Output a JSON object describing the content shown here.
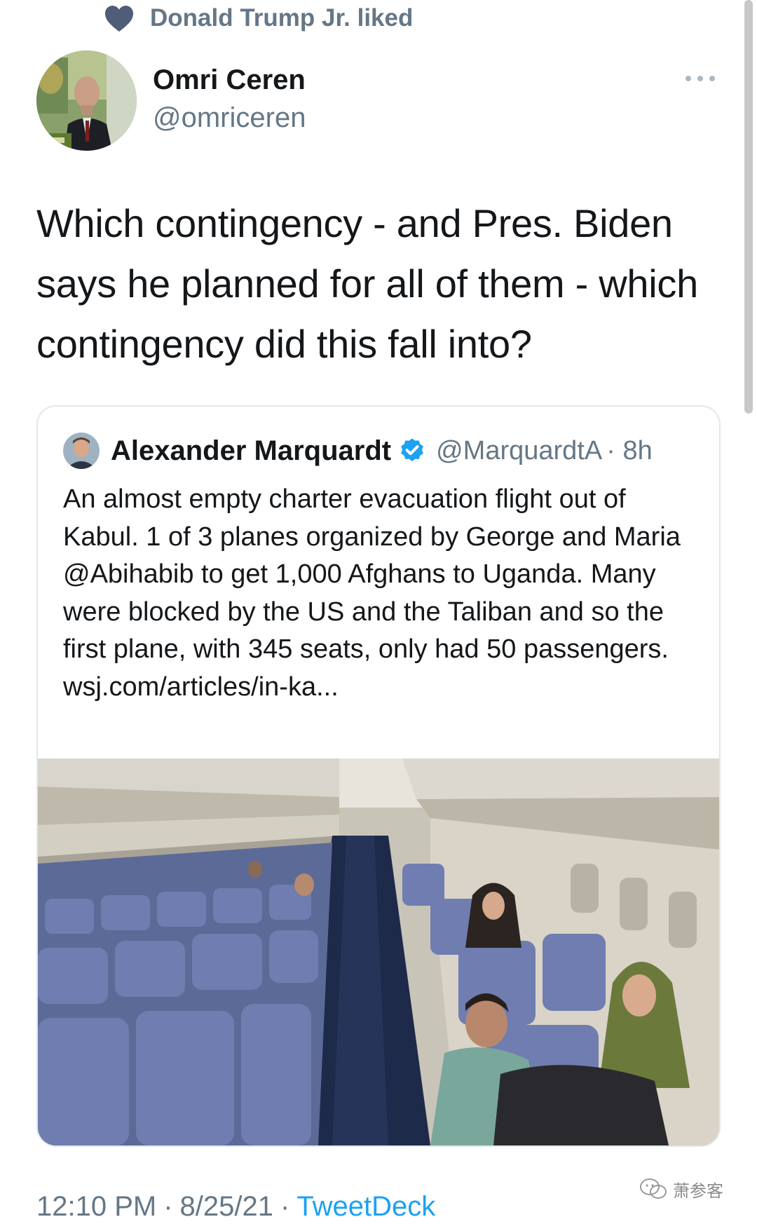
{
  "social_context": {
    "icon": "heart-icon",
    "text": "Donald Trump Jr. liked"
  },
  "author": {
    "name": "Omri Ceren",
    "handle": "@omriceren"
  },
  "tweet": {
    "text": "Which contingency - and Pres. Biden says he planned for all of them - which contingency did this fall into?"
  },
  "quoted_tweet": {
    "name": "Alexander Marquardt",
    "verified_icon": "verified-badge-icon",
    "handle": "@MarquardtA",
    "time": "· 8h",
    "text": "An almost empty charter evacuation flight out of Kabul. 1 of 3 planes organized by George and Maria @Abihabib to get 1,000 Afghans to Uganda. Many were blocked by the US and the Taliban and so the first plane, with 345 seats, only had 50 passengers. wsj.com/articles/in-ka...",
    "photo_icon": "aircraft-cabin-photo"
  },
  "footer": {
    "time": "12:10 PM",
    "date": "8/25/21",
    "separator": "·",
    "client": "TweetDeck"
  },
  "watermark": {
    "icon": "wechat-icon",
    "text": "萧参客"
  },
  "colors": {
    "secondary_text": "#657786",
    "link": "#1da1f2",
    "border": "#e1e8ed",
    "verified": "#1da1f2"
  }
}
